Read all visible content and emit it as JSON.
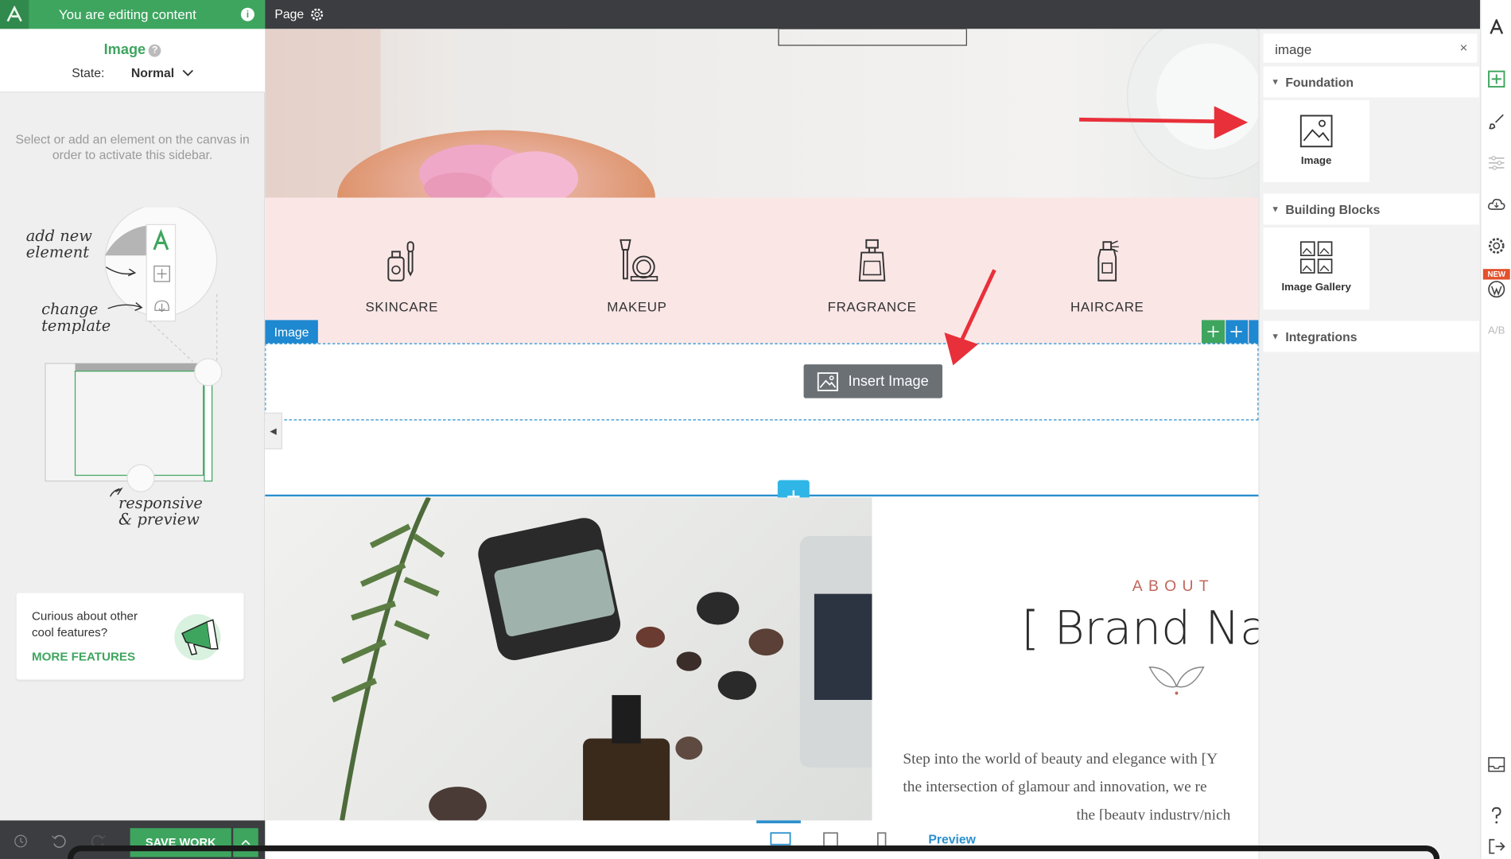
{
  "left_sidebar": {
    "banner_text": "You are editing content",
    "element_title": "Image",
    "state_label": "State:",
    "state_value": "Normal",
    "hint": "Select or add an element on the canvas in order to activate this sidebar.",
    "annotations": {
      "add_new": "add new element",
      "change_template": "change template",
      "responsive": "responsive & preview"
    },
    "features_card": {
      "text": "Curious about other cool features?",
      "link": "MORE FEATURES"
    },
    "save_label": "SAVE WORK"
  },
  "topbar": {
    "page_label": "Page"
  },
  "canvas": {
    "categories": [
      {
        "label": "SKINCARE",
        "icon": "skincare-icon"
      },
      {
        "label": "MAKEUP",
        "icon": "makeup-icon"
      },
      {
        "label": "FRAGRANCE",
        "icon": "fragrance-icon"
      },
      {
        "label": "HAIRCARE",
        "icon": "haircare-icon"
      }
    ],
    "image_tag": "Image",
    "insert_image_label": "Insert Image",
    "about": {
      "kicker": "ABOUT",
      "title": "[ Brand Nar",
      "lines": [
        "Step into the world of beauty and elegance with [Y",
        "the intersection of glamour and innovation, we re",
        "the [beauty industry/nich"
      ]
    },
    "preview_label": "Preview"
  },
  "right_panel": {
    "search_value": "image",
    "sections": [
      {
        "title": "Foundation",
        "items": [
          "Image"
        ]
      },
      {
        "title": "Building Blocks",
        "items": [
          "Image Gallery"
        ]
      },
      {
        "title": "Integrations",
        "items": []
      }
    ],
    "new_badge": "NEW"
  },
  "colors": {
    "accent_green": "#3ea55f",
    "selection_blue": "#2b8fce",
    "dark_bar": "#3b3d40",
    "category_bg": "#fbe6e6",
    "arrow_red": "#e8303a"
  }
}
